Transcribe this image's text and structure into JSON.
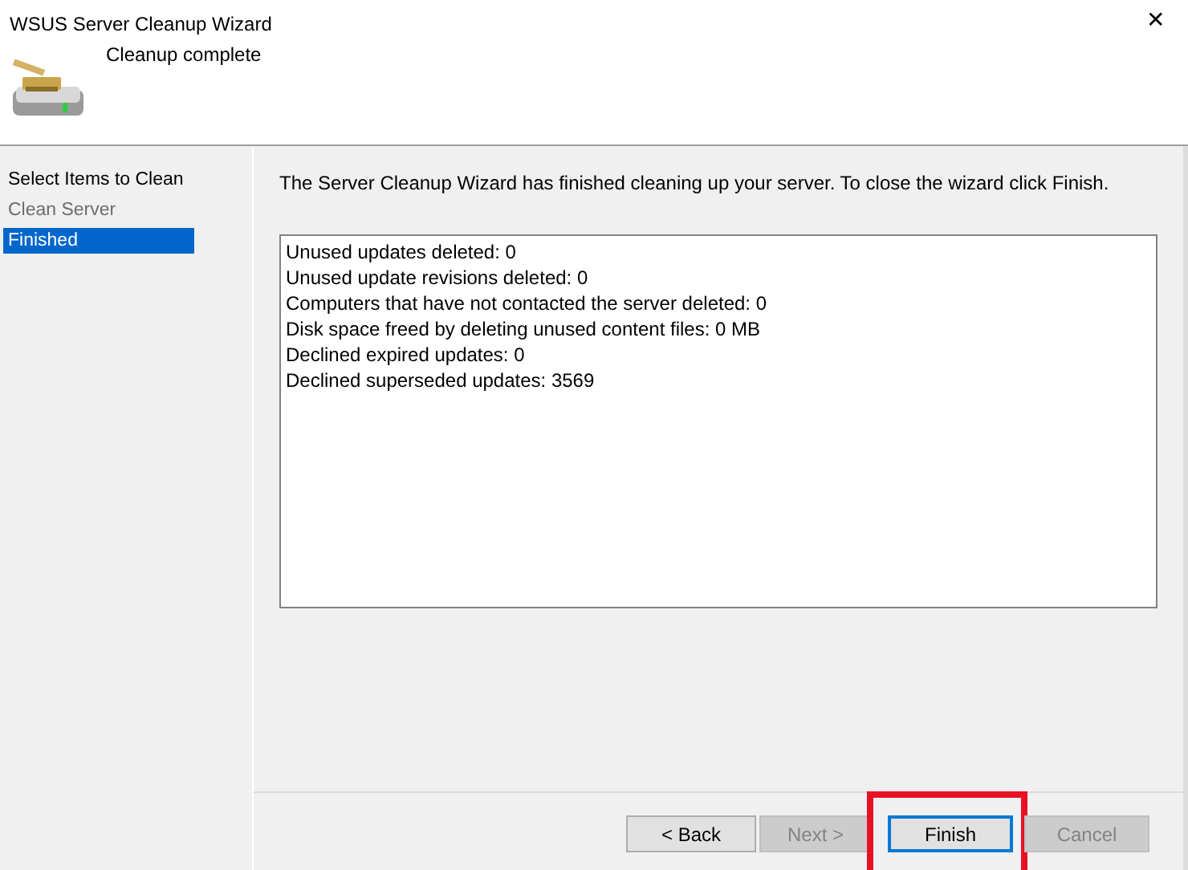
{
  "window": {
    "title": "WSUS Server Cleanup Wizard",
    "close": "✕"
  },
  "header": {
    "title": "Cleanup complete"
  },
  "sidebar": {
    "items": [
      {
        "label": "Select Items to Clean",
        "selected": false,
        "disabled": false
      },
      {
        "label": "Clean Server",
        "selected": false,
        "disabled": true
      },
      {
        "label": "Finished",
        "selected": true,
        "disabled": false
      }
    ]
  },
  "intro": "The Server Cleanup Wizard has finished cleaning up your server. To close the wizard click Finish.",
  "results": [
    "Unused updates deleted: 0",
    "Unused update revisions deleted: 0",
    "Computers that have not contacted the server deleted: 0",
    "Disk space freed by deleting unused content files: 0 MB",
    "Declined expired updates: 0",
    "Declined superseded updates: 3569"
  ],
  "buttons": [
    {
      "label": "< Back",
      "disabled": false,
      "default": false,
      "highlighted": false
    },
    {
      "label": "Next >",
      "disabled": true,
      "default": false,
      "highlighted": false
    },
    {
      "label": "Finish",
      "disabled": false,
      "default": true,
      "highlighted": true
    },
    {
      "label": "Cancel",
      "disabled": true,
      "default": false,
      "highlighted": false
    }
  ]
}
